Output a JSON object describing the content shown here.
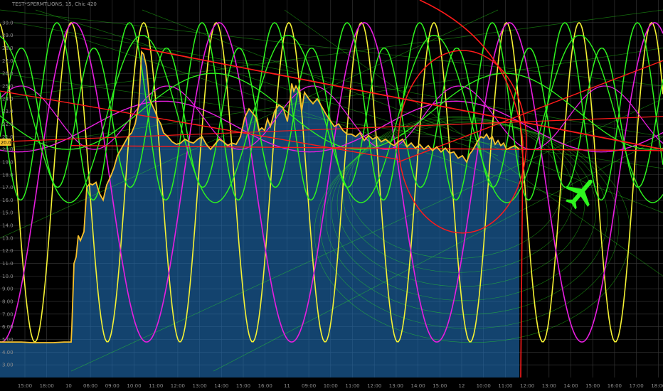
{
  "header": {
    "symbol_label": "TEST*SPERMTLIONS, 15, Chic 420"
  },
  "chart_data": {
    "type": "line",
    "y_ticks": [
      "30.0",
      "29.0",
      "28.0",
      "27.0",
      "26.0",
      "25.0",
      "24.0",
      "23.0",
      "22.0",
      "21.0",
      "20.0",
      "19.0",
      "18.0",
      "17.0",
      "16.0",
      "15.0",
      "14.0",
      "13.0",
      "12.0",
      "11.0",
      "10.0",
      "9.00",
      "8.00",
      "7.00",
      "6.00",
      "5.00",
      "4.00",
      "3.00"
    ],
    "x_ticks": [
      "15:00",
      "18:00",
      "10",
      "06:00",
      "09:00",
      "10:00",
      "11:00",
      "12:00",
      "13:00",
      "14:00",
      "15:00",
      "16:00",
      "11",
      "09:00",
      "10:00",
      "11:00",
      "12:00",
      "13:00",
      "14:00",
      "15:00",
      "12",
      "10:00",
      "11:00",
      "12:00",
      "13:00",
      "14:00",
      "15:00",
      "16:00",
      "17:00",
      "18:00"
    ],
    "ylim": [
      2.0,
      31.0
    ],
    "current_price": "20.00",
    "price": {
      "name": "price",
      "color": "#f7c12b",
      "x": [
        0,
        15,
        30,
        45,
        60,
        75,
        90,
        100,
        101,
        104,
        107,
        110,
        113,
        118,
        122,
        126,
        130,
        135,
        140,
        145,
        150,
        155,
        160,
        165,
        170,
        175,
        180,
        185,
        190,
        195,
        199,
        202,
        206,
        210,
        214,
        218,
        222,
        226,
        230,
        236,
        242,
        248,
        254,
        260,
        266,
        272,
        278,
        284,
        290,
        296,
        302,
        308,
        314,
        320,
        326,
        332,
        338,
        344,
        350,
        356,
        360,
        364,
        368,
        372,
        376,
        380,
        386,
        392,
        398,
        404,
        408,
        410,
        413,
        416,
        420,
        424,
        428,
        434,
        440,
        446,
        452,
        458,
        464,
        470,
        476,
        482,
        488,
        494,
        500,
        506,
        512,
        518,
        524,
        530,
        536,
        542,
        548,
        554,
        560,
        566,
        572,
        578,
        584,
        590,
        596,
        602,
        608,
        614,
        620,
        626,
        632,
        638,
        644,
        650,
        656,
        660,
        664,
        668,
        672,
        676,
        680,
        684,
        688,
        692,
        696,
        700,
        704,
        708,
        712,
        716,
        720,
        724,
        728,
        730
      ],
      "y": [
        4.8,
        4.8,
        4.8,
        4.75,
        4.75,
        4.75,
        4.8,
        4.8,
        6.0,
        11.0,
        11.5,
        13.2,
        12.8,
        13.5,
        17.0,
        17.3,
        17.2,
        17.4,
        16.5,
        16.0,
        17.2,
        17.8,
        18.5,
        19.5,
        20.0,
        20.5,
        21.0,
        21.3,
        22.0,
        23.5,
        27.7,
        27.5,
        26.5,
        24.0,
        23.5,
        23.0,
        22.4,
        22.0,
        21.3,
        21.0,
        20.6,
        20.4,
        20.5,
        20.8,
        20.6,
        20.5,
        20.8,
        21.0,
        20.4,
        20.0,
        20.4,
        20.8,
        20.6,
        20.3,
        20.5,
        20.4,
        21.0,
        22.5,
        23.2,
        22.8,
        22.5,
        21.5,
        21.7,
        21.5,
        22.4,
        21.8,
        23.0,
        23.5,
        23.3,
        22.2,
        24.0,
        25.2,
        24.6,
        25.0,
        24.6,
        23.0,
        24.5,
        24.0,
        23.6,
        24.0,
        23.4,
        22.8,
        22.3,
        21.8,
        22.0,
        21.5,
        21.2,
        21.2,
        21.0,
        21.3,
        20.7,
        21.1,
        20.8,
        21.0,
        20.6,
        20.8,
        20.5,
        20.3,
        20.6,
        20.8,
        20.2,
        20.5,
        20.1,
        20.4,
        20.0,
        20.3,
        19.9,
        20.2,
        19.8,
        20.1,
        19.7,
        19.8,
        19.3,
        19.5,
        19.0,
        19.6,
        19.9,
        20.3,
        20.7,
        21.0,
        20.9,
        21.2,
        20.8,
        21.0,
        20.4,
        20.7,
        20.3,
        20.5,
        20.0,
        20.1,
        20.2,
        20.3,
        20.1,
        20.0
      ]
    }
  }
}
